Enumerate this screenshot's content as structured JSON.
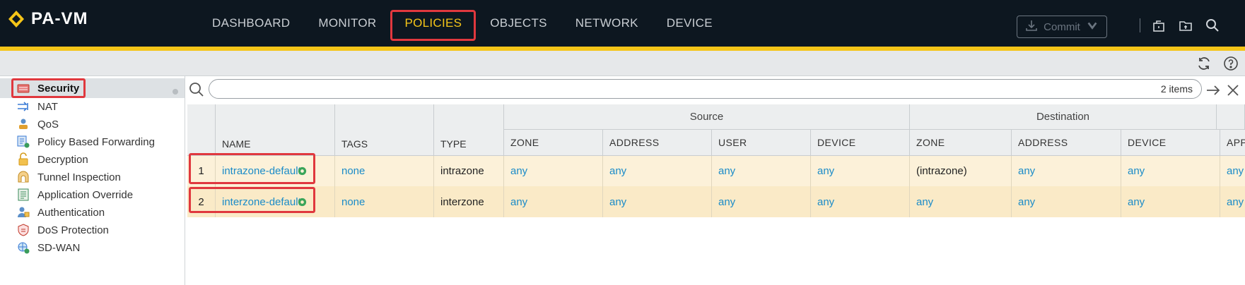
{
  "app": {
    "name": "PA-VM"
  },
  "nav": {
    "items": [
      {
        "label": "DASHBOARD",
        "active": false
      },
      {
        "label": "MONITOR",
        "active": false
      },
      {
        "label": "POLICIES",
        "active": true
      },
      {
        "label": "OBJECTS",
        "active": false
      },
      {
        "label": "NETWORK",
        "active": false
      },
      {
        "label": "DEVICE",
        "active": false
      }
    ],
    "commit_label": "Commit"
  },
  "sidebar": {
    "items": [
      {
        "label": "Security",
        "icon": "security-rule-icon",
        "active": true
      },
      {
        "label": "NAT",
        "icon": "nat-icon"
      },
      {
        "label": "QoS",
        "icon": "qos-icon"
      },
      {
        "label": "Policy Based Forwarding",
        "icon": "pbf-icon"
      },
      {
        "label": "Decryption",
        "icon": "decryption-lock-icon"
      },
      {
        "label": "Tunnel Inspection",
        "icon": "tunnel-inspection-icon"
      },
      {
        "label": "Application Override",
        "icon": "application-override-icon"
      },
      {
        "label": "Authentication",
        "icon": "authentication-icon"
      },
      {
        "label": "DoS Protection",
        "icon": "dos-protection-icon"
      },
      {
        "label": "SD-WAN",
        "icon": "sd-wan-icon"
      }
    ]
  },
  "search": {
    "placeholder": "",
    "count": "2 items"
  },
  "table": {
    "group_headers": {
      "source": "Source",
      "destination": "Destination"
    },
    "columns": {
      "name": "NAME",
      "tags": "TAGS",
      "type": "TYPE",
      "src_zone": "ZONE",
      "src_address": "ADDRESS",
      "src_user": "USER",
      "src_device": "DEVICE",
      "dst_zone": "ZONE",
      "dst_address": "ADDRESS",
      "dst_device": "DEVICE",
      "app": "APP"
    },
    "rows": [
      {
        "num": "1",
        "name": "intrazone-default",
        "tags": "none",
        "type": "intrazone",
        "src_zone": "any",
        "src_address": "any",
        "src_user": "any",
        "src_device": "any",
        "dst_zone": "(intrazone)",
        "dst_address": "any",
        "dst_device": "any",
        "app": "any"
      },
      {
        "num": "2",
        "name": "interzone-default",
        "tags": "none",
        "type": "interzone",
        "src_zone": "any",
        "src_address": "any",
        "src_user": "any",
        "src_device": "any",
        "dst_zone": "any",
        "dst_address": "any",
        "dst_device": "any",
        "app": "any"
      }
    ]
  },
  "colors": {
    "accent": "#f5c518",
    "highlight": "#e0383e",
    "link": "#1a8bc8",
    "topbar": "#0d1720"
  }
}
